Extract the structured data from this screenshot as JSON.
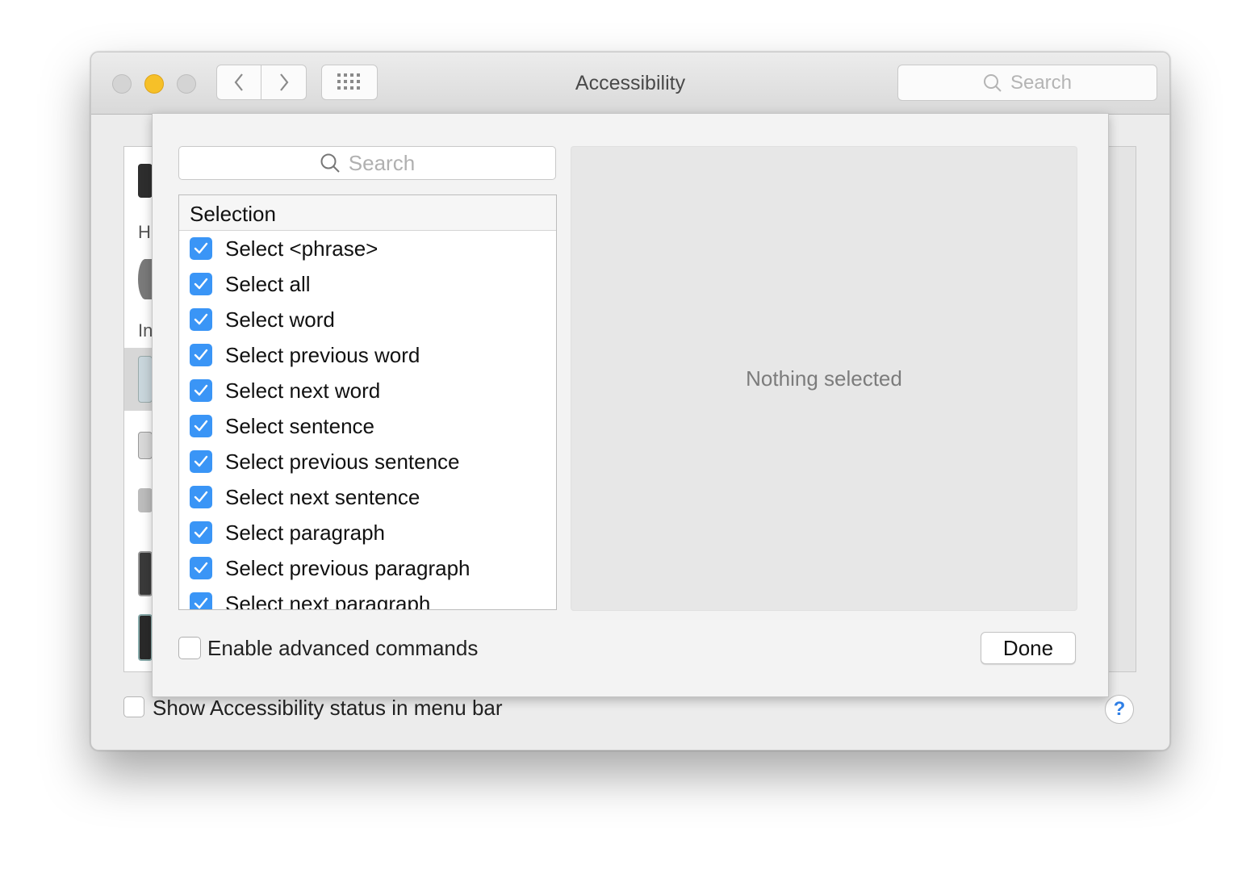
{
  "window": {
    "title": "Accessibility",
    "search_placeholder": "Search"
  },
  "background": {
    "sidebar_fragments": [
      "H",
      "In"
    ],
    "status_menu_label": "Show Accessibility status in menu bar",
    "help_label": "?"
  },
  "sheet": {
    "search_placeholder": "Search",
    "list_header": "Selection",
    "commands": [
      {
        "label": "Select <phrase>",
        "checked": true
      },
      {
        "label": "Select all",
        "checked": true
      },
      {
        "label": "Select word",
        "checked": true
      },
      {
        "label": "Select previous word",
        "checked": true
      },
      {
        "label": "Select next word",
        "checked": true
      },
      {
        "label": "Select sentence",
        "checked": true
      },
      {
        "label": "Select previous sentence",
        "checked": true
      },
      {
        "label": "Select next sentence",
        "checked": true
      },
      {
        "label": "Select paragraph",
        "checked": true
      },
      {
        "label": "Select previous paragraph",
        "checked": true
      },
      {
        "label": "Select next paragraph",
        "checked": true
      }
    ],
    "detail_text": "Nothing selected",
    "advanced_label": "Enable advanced commands",
    "done_label": "Done"
  },
  "colors": {
    "checkbox_accent": "#3a95f6",
    "minimize_light": "#f6c028",
    "help_accent": "#2f7fe6"
  }
}
